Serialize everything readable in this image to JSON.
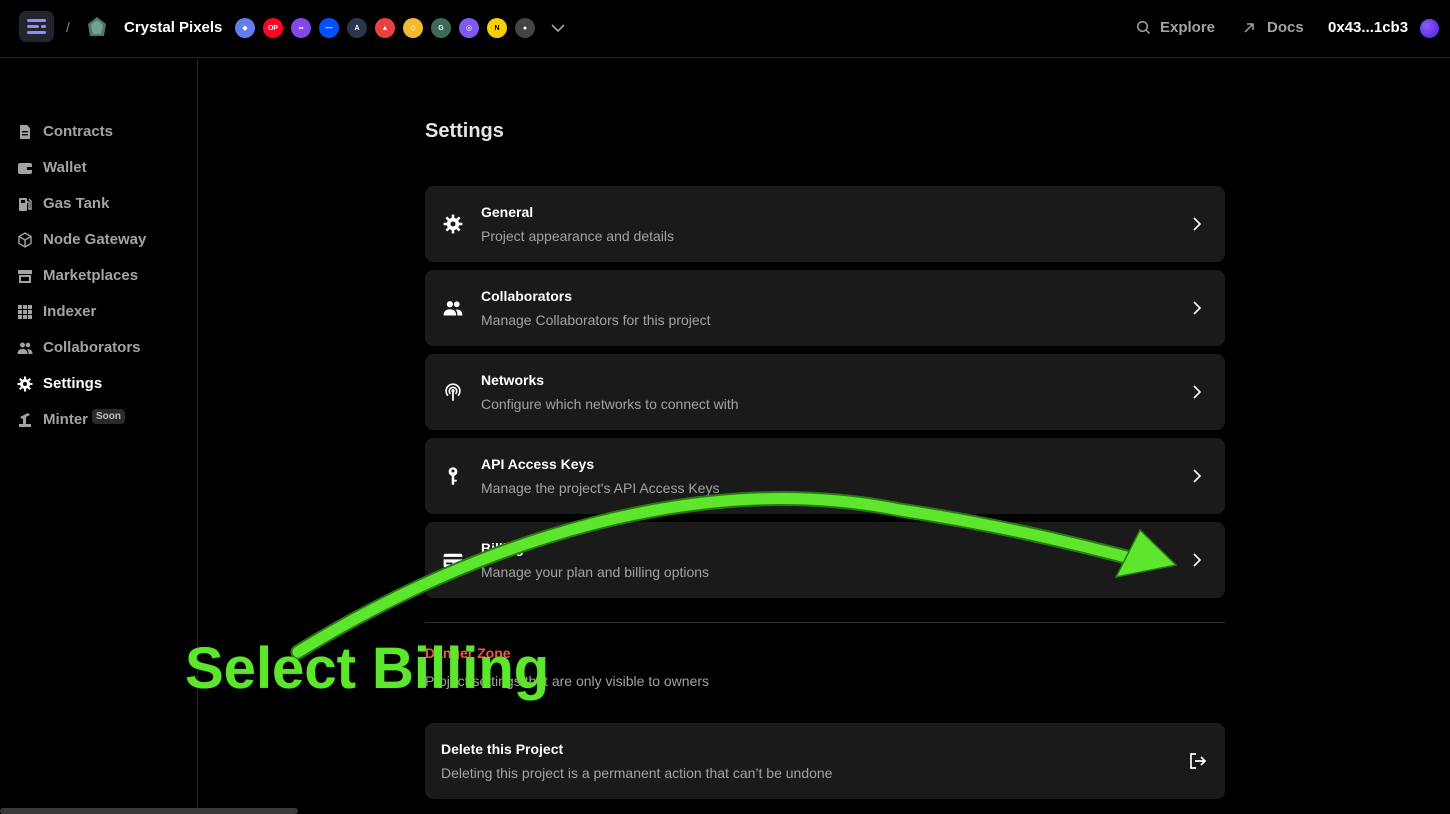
{
  "topbar": {
    "separator": "/",
    "project_name": "Crystal Pixels",
    "chains": [
      {
        "icon": "ethereum-icon",
        "color": "#627eea",
        "label": "◆"
      },
      {
        "icon": "optimism-icon",
        "color": "#ff0420",
        "label": "OP"
      },
      {
        "icon": "polygon-icon",
        "color": "#8247e5",
        "label": "∞"
      },
      {
        "icon": "base-icon",
        "color": "#0052ff",
        "label": "—"
      },
      {
        "icon": "arbitrum-icon",
        "color": "#2d374b",
        "label": "A"
      },
      {
        "icon": "avalanche-icon",
        "color": "#e84142",
        "label": "▲"
      },
      {
        "icon": "bnb-icon",
        "color": "#f3ba2f",
        "label": "◇"
      },
      {
        "icon": "gnosis-icon",
        "color": "#3e6957",
        "label": "G"
      },
      {
        "icon": "chain-globe-icon",
        "color": "#7f5af0",
        "label": "◎"
      },
      {
        "icon": "nova-icon",
        "color": "#f5d000",
        "label": "N"
      },
      {
        "icon": "chain-misc-icon",
        "color": "#444444",
        "label": "●"
      }
    ],
    "explore_label": "Explore",
    "docs_label": "Docs",
    "wallet_address": "0x43...1cb3"
  },
  "sidebar": {
    "items": [
      {
        "label": "Contracts",
        "icon": "file-icon",
        "active": false
      },
      {
        "label": "Wallet",
        "icon": "wallet-icon",
        "active": false
      },
      {
        "label": "Gas Tank",
        "icon": "gas-pump-icon",
        "active": false
      },
      {
        "label": "Node Gateway",
        "icon": "cube-icon",
        "active": false
      },
      {
        "label": "Marketplaces",
        "icon": "store-icon",
        "active": false
      },
      {
        "label": "Indexer",
        "icon": "grid-icon",
        "active": false
      },
      {
        "label": "Collaborators",
        "icon": "people-icon",
        "active": false
      },
      {
        "label": "Settings",
        "icon": "gear-icon",
        "active": true
      },
      {
        "label": "Minter",
        "icon": "minter-icon",
        "active": false,
        "badge": "Soon"
      }
    ]
  },
  "main": {
    "title": "Settings",
    "cards": [
      {
        "title": "General",
        "description": "Project appearance and details",
        "icon": "gear-icon"
      },
      {
        "title": "Collaborators",
        "description": "Manage Collaborators for this project",
        "icon": "people-icon"
      },
      {
        "title": "Networks",
        "description": "Configure which networks to connect with",
        "icon": "broadcast-icon"
      },
      {
        "title": "API Access Keys",
        "description": "Manage the project's API Access Keys",
        "icon": "key-icon"
      },
      {
        "title": "Billing",
        "description": "Manage your plan and billing options",
        "icon": "credit-card-icon"
      }
    ],
    "danger_zone": {
      "title": "Danger Zone",
      "description": "Project settings that are only visible to owners",
      "delete_title": "Delete this Project",
      "delete_description": "Deleting this project is a permanent action that can’t be undone"
    }
  },
  "annotation": {
    "text": "Select Billing",
    "color": "#5ee62e"
  }
}
